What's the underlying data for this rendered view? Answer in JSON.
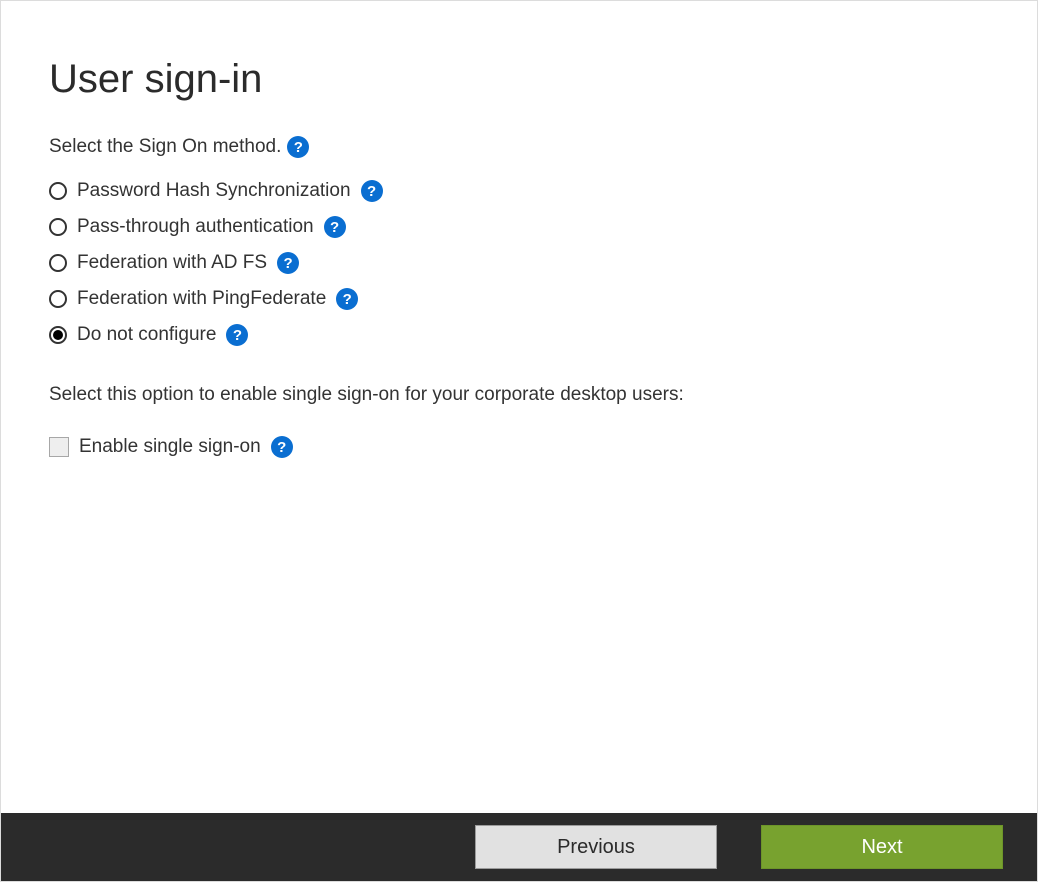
{
  "title": "User sign-in",
  "prompt": "Select the Sign On method.",
  "options": [
    {
      "label": "Password Hash Synchronization",
      "selected": false
    },
    {
      "label": "Pass-through authentication",
      "selected": false
    },
    {
      "label": "Federation with AD FS",
      "selected": false
    },
    {
      "label": "Federation with PingFederate",
      "selected": false
    },
    {
      "label": "Do not configure",
      "selected": true
    }
  ],
  "sso_prompt": "Select this option to enable single sign-on for your corporate desktop users:",
  "checkbox": {
    "label": "Enable single sign-on",
    "checked": false,
    "enabled": false
  },
  "help_glyph": "?",
  "footer": {
    "previous": "Previous",
    "next": "Next"
  }
}
